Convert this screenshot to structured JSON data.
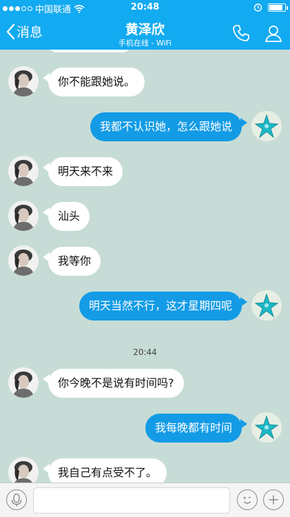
{
  "status_bar": {
    "carrier": "中国联通",
    "time": "20:48",
    "battery_level": 0.85
  },
  "nav": {
    "back_label": "消息",
    "title": "黄泽欣",
    "subtitle": "手机在线 - WiFi"
  },
  "messages": [
    {
      "side": "in",
      "text": "你不能跟她说。"
    },
    {
      "side": "out",
      "text": "我都不认识她，怎么跟她说"
    },
    {
      "side": "in",
      "text": "明天来不来"
    },
    {
      "side": "in",
      "text": "汕头"
    },
    {
      "side": "in",
      "text": "我等你"
    },
    {
      "side": "out",
      "text": "明天当然不行，这才星期四呢"
    },
    {
      "side": "in",
      "text": "你今晚不是说有时间吗?"
    },
    {
      "side": "out",
      "text": "我每晚都有时间"
    },
    {
      "side": "in",
      "text": "我自己有点受不了。"
    }
  ],
  "timestamp": "20:44",
  "input": {
    "value": ""
  },
  "colors": {
    "accent": "#12aaf0",
    "out_bubble": "#139be6",
    "background": "#c7dcd6"
  }
}
